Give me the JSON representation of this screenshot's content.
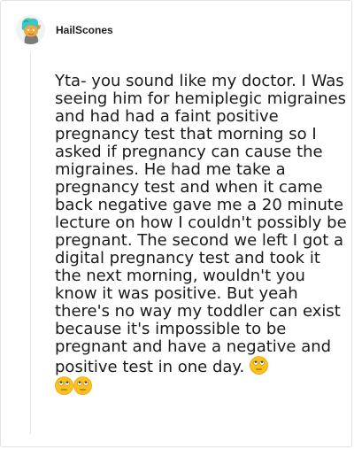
{
  "post": {
    "username": "HailScones",
    "avatar_icon": "snoo-avatar-icon",
    "body_text": "Yta- you sound like my doctor. I Was seeing him for hemiplegic migraines and had had a faint positive pregnancy test that morning so I asked if pregnancy can cause the migraines. He had me take a pregnancy test and when it came back negative gave me a 20 minute lecture on how I couldn't possibly be pregnant. The second we left I got a digital pregnancy test and took it the next morning, wouldn't you know it was positive. But yeah there's no way my toddler can exist because it's impossible to be pregnant and have a negative and positive test in one day.",
    "emojis": [
      "eye-roll-emoji",
      "eye-roll-emoji",
      "eye-roll-emoji"
    ]
  },
  "colors": {
    "border": "#e3e3e3",
    "text": "#1a1a1a",
    "emoji_face": "#fcc21b"
  }
}
